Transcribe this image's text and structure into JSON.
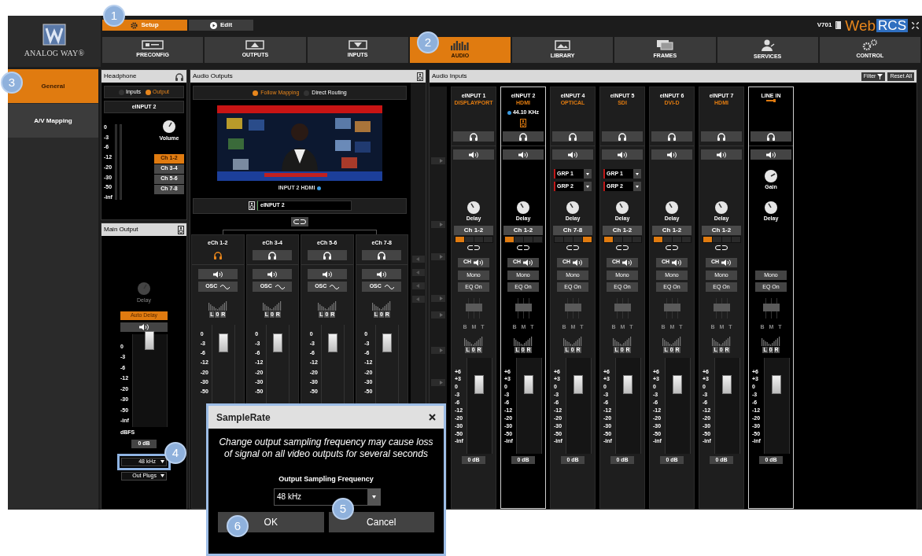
{
  "app": {
    "logo_text": "ANALOG WAY®",
    "version": "V701",
    "brand_web": "Web",
    "brand_rcs": "RCS"
  },
  "mode_tabs": [
    {
      "label": "Setup",
      "selected": true
    },
    {
      "label": "Edit",
      "selected": false
    }
  ],
  "nav_tabs": [
    {
      "label": "PRECONFIG",
      "selected": false
    },
    {
      "label": "OUTPUTS",
      "selected": false
    },
    {
      "label": "INPUTS",
      "selected": false
    },
    {
      "label": "AUDIO",
      "selected": true
    },
    {
      "label": "LIBRARY",
      "selected": false
    },
    {
      "label": "FRAMES",
      "selected": false
    },
    {
      "label": "SERVICES",
      "selected": false
    },
    {
      "label": "CONTROL",
      "selected": false
    }
  ],
  "sidebar": [
    {
      "label": "General",
      "selected": true
    },
    {
      "label": "A/V Mapping",
      "selected": false
    }
  ],
  "headphone": {
    "title": "Headphone",
    "sources": [
      {
        "label": "Inputs",
        "selected": false
      },
      {
        "label": "Output",
        "selected": true
      }
    ],
    "source_name": "eINPUT 2",
    "scale": [
      "0",
      "-3",
      "-6",
      "-12",
      "-20",
      "-30",
      "-50",
      "-inf"
    ],
    "knob_label": "Volume",
    "channels": [
      {
        "label": "Ch 1-2",
        "selected": true
      },
      {
        "label": "Ch 3-4",
        "selected": false
      },
      {
        "label": "Ch 5-6",
        "selected": false
      },
      {
        "label": "Ch 7-8",
        "selected": false
      }
    ]
  },
  "main_output": {
    "title": "Main Output",
    "knob_label": "Delay",
    "auto_delay": "Auto Delay",
    "scale": [
      "0",
      "-3",
      "-6",
      "-12",
      "-20",
      "-30",
      "-50",
      "-inf"
    ],
    "level": 0.93,
    "unit": "dBFS",
    "gain": "0 dB",
    "sample_rate": "48 kHz",
    "plugs": "Out Plugs"
  },
  "audio_outputs": {
    "title": "Audio Outputs",
    "modes": [
      {
        "label": "Follow Mapping",
        "selected": true
      },
      {
        "label": "Direct Routing",
        "selected": false
      }
    ],
    "preview_caption": "INPUT 2  HDMI",
    "source_field": "eINPUT 2",
    "channels": [
      {
        "name": "eCh 1-2",
        "monitored": true,
        "osc": "OSC",
        "balance": [
          "L",
          "0",
          "R"
        ],
        "scale": [
          "0",
          "-3",
          "-6",
          "-12",
          "-20",
          "-30",
          "-50"
        ],
        "level": 0.9
      },
      {
        "name": "eCh 3-4",
        "monitored": false,
        "osc": "OSC",
        "balance": [
          "L",
          "0",
          "R"
        ],
        "scale": [
          "0",
          "-3",
          "-6",
          "-12",
          "-20",
          "-30",
          "-50"
        ],
        "level": 0.9
      },
      {
        "name": "eCh 5-6",
        "monitored": false,
        "osc": "OSC",
        "balance": [
          "L",
          "0",
          "R"
        ],
        "scale": [
          "0",
          "-3",
          "-6",
          "-12",
          "-20",
          "-30",
          "-50"
        ],
        "level": 0.9
      },
      {
        "name": "eCh 7-8",
        "monitored": false,
        "osc": "OSC",
        "balance": [
          "L",
          "0",
          "R"
        ],
        "scale": [
          "0",
          "-3",
          "-6",
          "-12",
          "-20",
          "-30",
          "-50"
        ],
        "level": 0.9
      }
    ]
  },
  "audio_inputs": {
    "title": "Audio Inputs",
    "filter": "Filter",
    "reset": "Reset All",
    "strips": [
      {
        "kind": "input",
        "name": "eINPUT 1",
        "source": "DISPLAYPORT",
        "selected": false,
        "channel": "Ch 1-2",
        "pairs": [
          true,
          false,
          false,
          false
        ],
        "ch_button": "CH",
        "mono": "Mono",
        "eq": "EQ On",
        "eq_bands": [
          "B",
          "M",
          "T"
        ],
        "balance": [
          "L",
          "0",
          "R"
        ],
        "delay_label": "Delay",
        "scale": [
          "+6",
          "+3",
          "0",
          "-3",
          "-6",
          "-12",
          "-20",
          "-30",
          "-50",
          "-inf"
        ],
        "level": 0.72,
        "gain": "0 dB"
      },
      {
        "kind": "input",
        "name": "eINPUT 2",
        "source": "HDMI",
        "selected": true,
        "frequency": "44.10 KHz",
        "channel": "Ch 1-2",
        "pairs": [
          true,
          false,
          false,
          false
        ],
        "ch_button": "CH",
        "mono": "Mono",
        "eq": "EQ On",
        "eq_bands": [
          "B",
          "M",
          "T"
        ],
        "balance": [
          "L",
          "0",
          "R"
        ],
        "delay_label": "Delay",
        "scale": [
          "+6",
          "+3",
          "0",
          "-3",
          "-6",
          "-12",
          "-20",
          "-30",
          "-50",
          "-inf"
        ],
        "level": 0.72,
        "gain": "0 dB"
      },
      {
        "kind": "input",
        "name": "eINPUT 4",
        "source": "OPTICAL",
        "selected": false,
        "groups": [
          "GRP 1",
          "GRP 2"
        ],
        "channel": "Ch 7-8",
        "pairs": [
          false,
          false,
          false,
          true
        ],
        "ch_button": "CH",
        "mono": "Mono",
        "eq": "EQ On",
        "eq_bands": [
          "B",
          "M",
          "T"
        ],
        "balance": [
          "L",
          "0",
          "R"
        ],
        "delay_label": "Delay",
        "scale": [
          "+6",
          "+3",
          "0",
          "-3",
          "-6",
          "-12",
          "-20",
          "-30",
          "-50",
          "-inf"
        ],
        "level": 0.72,
        "gain": "0 dB"
      },
      {
        "kind": "input",
        "name": "eINPUT 5",
        "source": "SDI",
        "selected": false,
        "groups": [
          "GRP 1",
          "GRP 2"
        ],
        "channel": "Ch 1-2",
        "pairs": [
          true,
          false,
          false,
          false
        ],
        "ch_button": "CH",
        "mono": "Mono",
        "eq": "EQ On",
        "eq_bands": [
          "B",
          "M",
          "T"
        ],
        "balance": [
          "L",
          "0",
          "R"
        ],
        "delay_label": "Delay",
        "scale": [
          "+6",
          "+3",
          "0",
          "-3",
          "-6",
          "-12",
          "-20",
          "-30",
          "-50",
          "-inf"
        ],
        "level": 0.72,
        "gain": "0 dB"
      },
      {
        "kind": "input",
        "name": "eINPUT 6",
        "source": "DVI-D",
        "selected": false,
        "channel": "Ch 1-2",
        "pairs": [
          true,
          false,
          false,
          false
        ],
        "ch_button": "CH",
        "mono": "Mono",
        "eq": "EQ On",
        "eq_bands": [
          "B",
          "M",
          "T"
        ],
        "balance": [
          "L",
          "0",
          "R"
        ],
        "delay_label": "Delay",
        "scale": [
          "+6",
          "+3",
          "0",
          "-3",
          "-6",
          "-12",
          "-20",
          "-30",
          "-50",
          "-inf"
        ],
        "level": 0.72,
        "gain": "0 dB"
      },
      {
        "kind": "input",
        "name": "eINPUT 7",
        "source": "HDMI",
        "selected": false,
        "channel": "Ch 1-2",
        "pairs": [
          true,
          false,
          false,
          false
        ],
        "ch_button": "CH",
        "mono": "Mono",
        "eq": "EQ On",
        "eq_bands": [
          "B",
          "M",
          "T"
        ],
        "balance": [
          "L",
          "0",
          "R"
        ],
        "delay_label": "Delay",
        "scale": [
          "+6",
          "+3",
          "0",
          "-3",
          "-6",
          "-12",
          "-20",
          "-30",
          "-50",
          "-inf"
        ],
        "level": 0.72,
        "gain": "0 dB"
      },
      {
        "kind": "line",
        "name": "LINE IN",
        "selected": true,
        "gain_label": "Gain",
        "mono": "Mono",
        "eq": "EQ On",
        "eq_bands": [
          "B",
          "M",
          "T"
        ],
        "balance": [
          "L",
          "0",
          "R"
        ],
        "delay_label": "Delay",
        "scale": [
          "+6",
          "+3",
          "0",
          "-3",
          "-6",
          "-12",
          "-20",
          "-30",
          "-50",
          "-inf"
        ],
        "level": 0.72,
        "gain": "0 dB"
      }
    ]
  },
  "dialog": {
    "title": "SampleRate",
    "message": "Change output sampling frequency may cause loss of signal on all video outputs for several seconds",
    "field_label": "Output Sampling Frequency",
    "value": "48 kHz",
    "buttons": [
      "OK",
      "Cancel"
    ]
  },
  "callouts": [
    "1",
    "2",
    "3",
    "4",
    "5",
    "6"
  ]
}
